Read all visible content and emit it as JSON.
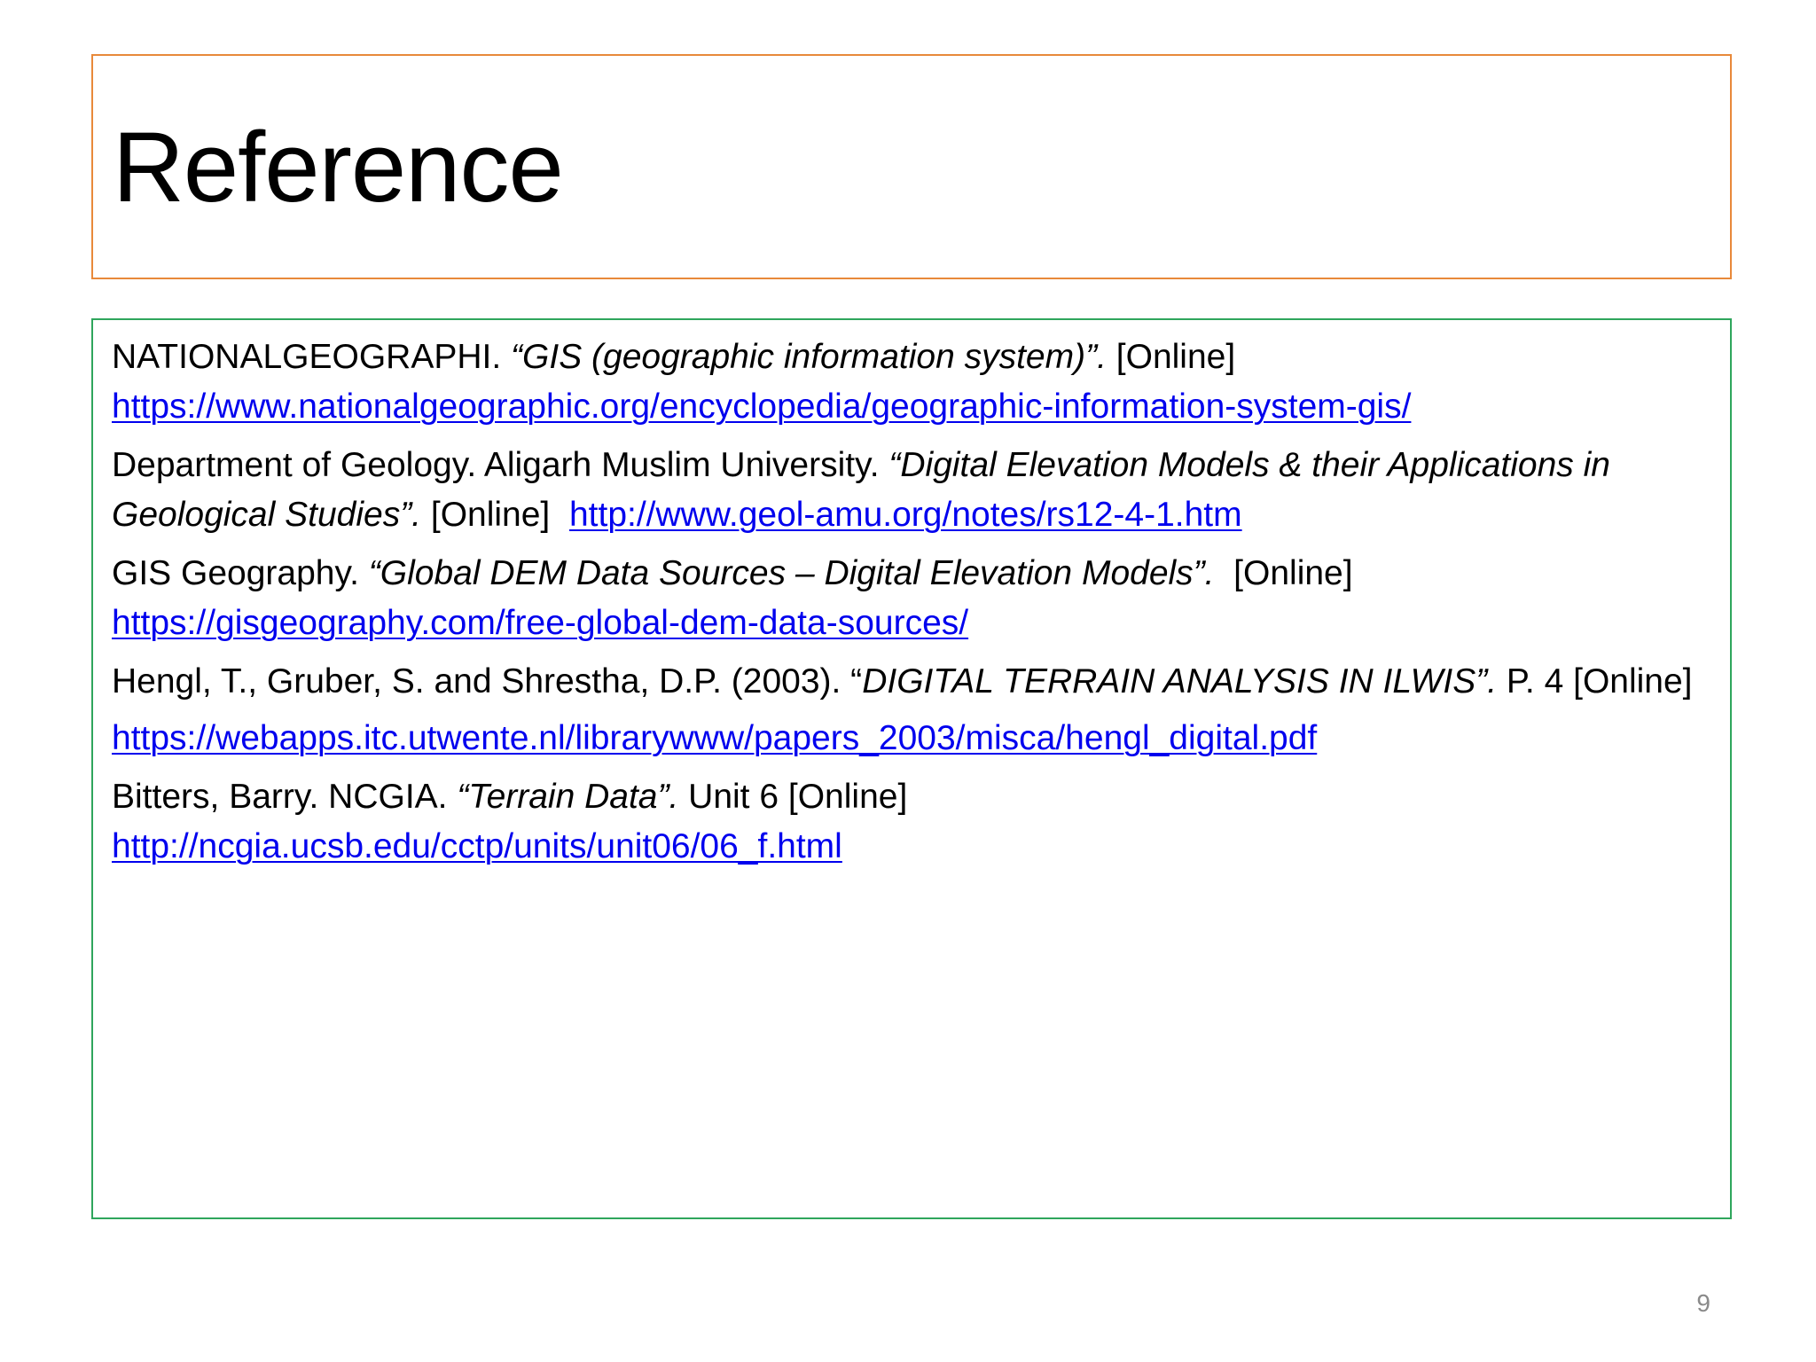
{
  "slide": {
    "title": "Reference",
    "page_number": "9",
    "border_colors": {
      "title_box": "#E8893A",
      "content_box": "#2FA65C"
    },
    "link_color": "#0000EE"
  },
  "references": [
    {
      "prefix": "NATIONALGEOGRAPHI. ",
      "title": "“GIS (geographic information system)”.",
      "suffix": " [Online]",
      "url": "https://www.nationalgeographic.org/encyclopedia/geographic-information-system-gis/"
    },
    {
      "prefix": "Department of Geology. Aligarh Muslim University. ",
      "title": "“Digital Elevation Models & their Applications in Geological Studies”.",
      "suffix": " [Online]  ",
      "url": "http://www.geol-amu.org/notes/rs12-4-1.htm"
    },
    {
      "prefix": "GIS Geography. ",
      "title": "“Global DEM Data Sources – Digital Elevation Models”.",
      "suffix": "  [Online]",
      "url": "https://gisgeography.com/free-global-dem-data-sources/"
    },
    {
      "prefix": "Hengl, T., Gruber, S. and Shrestha, D.P. (2003). “",
      "title": "DIGITAL TERRAIN ANALYSIS IN ILWIS”.",
      "suffix": " P. 4 [Online]",
      "url": "https://webapps.itc.utwente.nl/librarywww/papers_2003/misca/hengl_digital.pdf"
    },
    {
      "prefix": "Bitters, Barry. NCGIA. ",
      "title": "“Terrain Data”.",
      "suffix": " Unit 6 [Online]",
      "url": "http://ncgia.ucsb.edu/cctp/units/unit06/06_f.html"
    }
  ]
}
